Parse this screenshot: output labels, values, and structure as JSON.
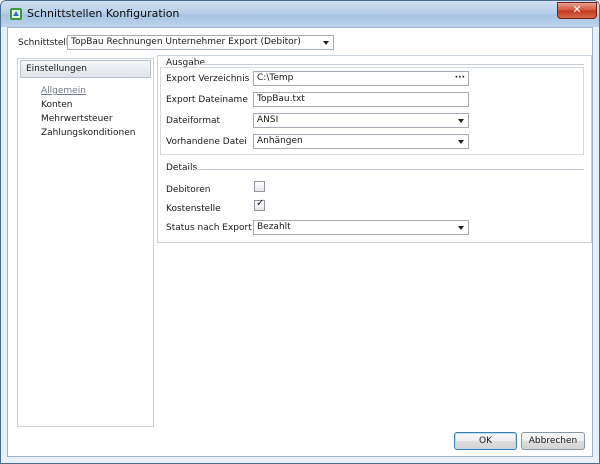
{
  "window": {
    "title": "Schnittstellen Konfiguration",
    "close_label": "✕"
  },
  "top": {
    "label": "Schnittstelle",
    "value": "TopBau Rechnungen Unternehmer Export (Debitor)"
  },
  "nav": {
    "header": "Einstellungen",
    "items": [
      "Allgemein",
      "Konten",
      "Mehrwertsteuer",
      "Zahlungskonditionen"
    ]
  },
  "ausgabe": {
    "title": "Ausgabe",
    "export_dir_label": "Export Verzeichnis",
    "export_dir_value": "C:\\Temp",
    "export_dir_browse": "···",
    "export_name_label": "Export Dateiname",
    "export_name_value": "TopBau.txt",
    "format_label": "Dateiformat",
    "format_value": "ANSI",
    "existing_label": "Vorhandene Datei",
    "existing_value": "Anhängen"
  },
  "details": {
    "title": "Details",
    "debitoren_label": "Debitoren",
    "debitoren_checked": false,
    "kostenstelle_label": "Kostenstelle",
    "kostenstelle_checked": true,
    "status_label": "Status nach Export",
    "status_value": "Bezahlt"
  },
  "buttons": {
    "ok": "OK",
    "cancel": "Abbrechen"
  },
  "colors": {
    "title_bar": "#b8cfe9",
    "close": "#c33a22",
    "ok_border": "#3c7fb1"
  }
}
